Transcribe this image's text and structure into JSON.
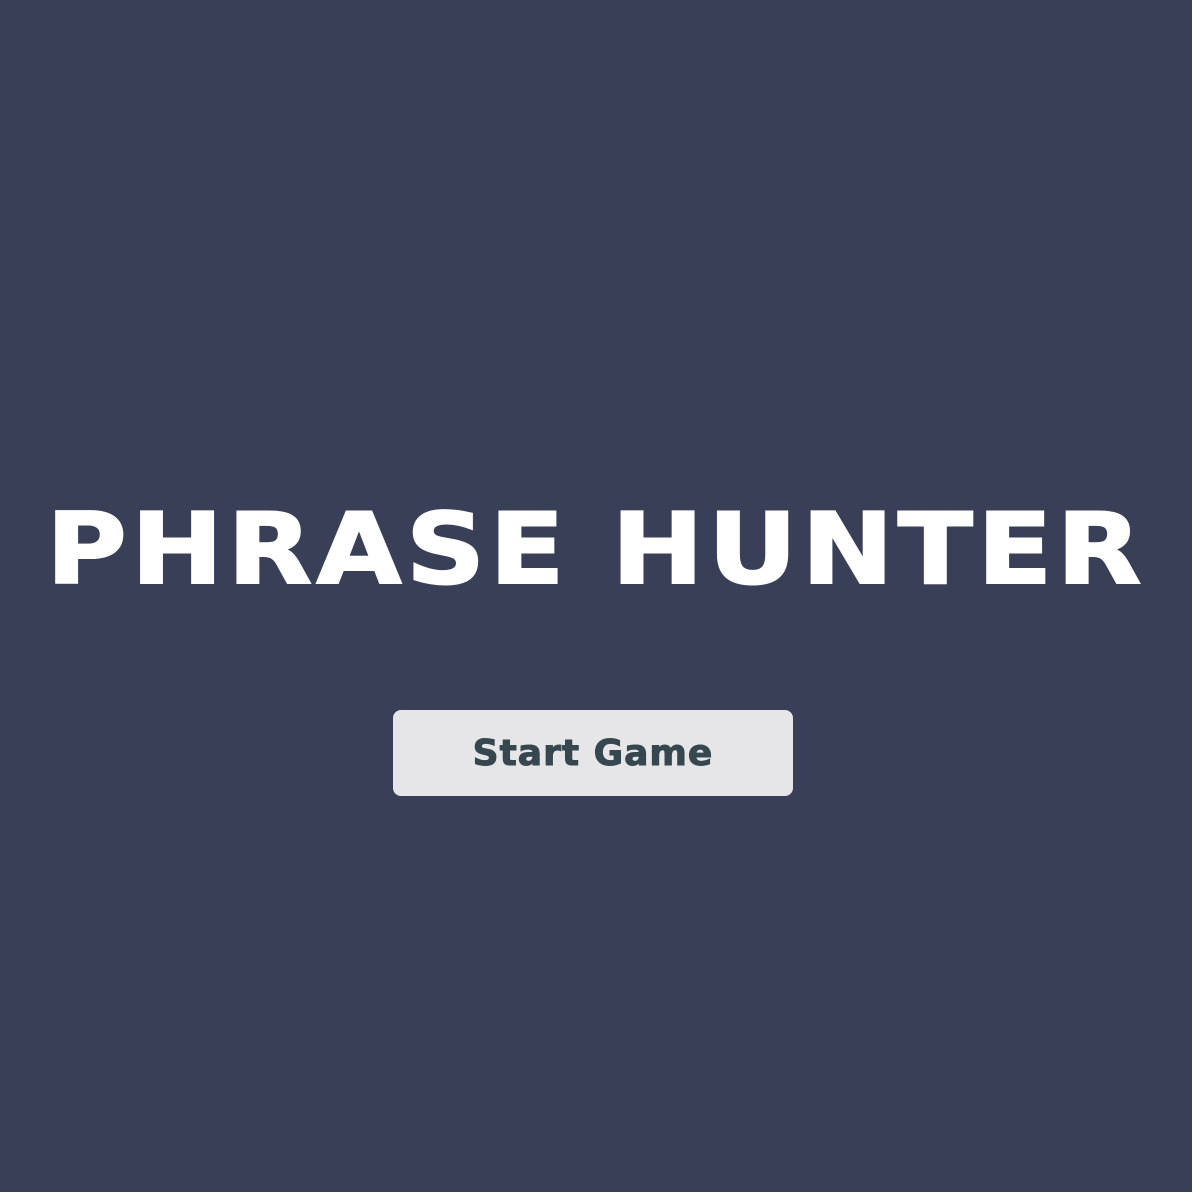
{
  "overlay": {
    "title": "PHRASE HUNTER",
    "start_button_label": "Start Game"
  },
  "colors": {
    "background": "#3a3f58",
    "title": "#ffffff",
    "button_background": "#e6e6e8",
    "button_text": "#37474f"
  }
}
